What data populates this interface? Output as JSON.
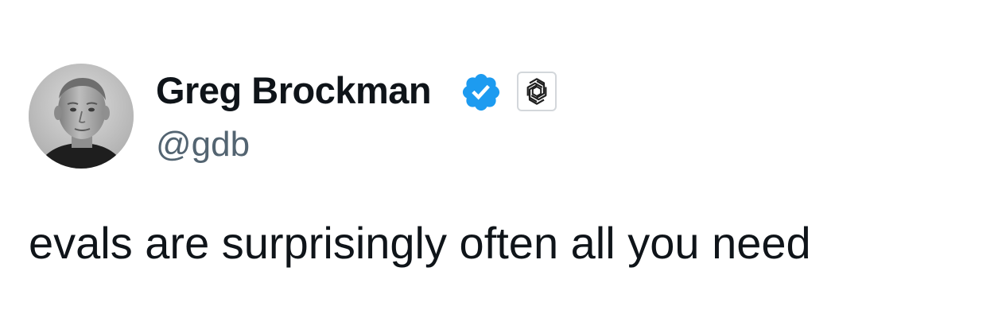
{
  "tweet": {
    "author": {
      "name": "Greg Brockman",
      "handle": "@gdb",
      "verified": true,
      "verified_color": "#1d9bf0",
      "affiliation_icon": "openai-logo-icon"
    },
    "text": "evals are surprisingly often all you need"
  }
}
